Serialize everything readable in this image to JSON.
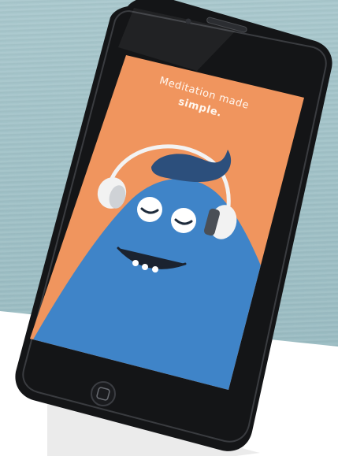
{
  "screen": {
    "tagline_line1": "Meditation made",
    "tagline_line2": "simple."
  },
  "colors": {
    "background_teal": "#a3c4ca",
    "screen_orange": "#f0955e",
    "mascot_blue": "#3f84c8",
    "hair_navy": "#2c4f7c",
    "phone_body": "#111214"
  },
  "icons": {
    "mascot": "meditating-blue-mascot-with-headphones",
    "home_button": "home-button-icon",
    "speaker": "earpiece-speaker-icon",
    "camera": "front-camera-icon"
  }
}
